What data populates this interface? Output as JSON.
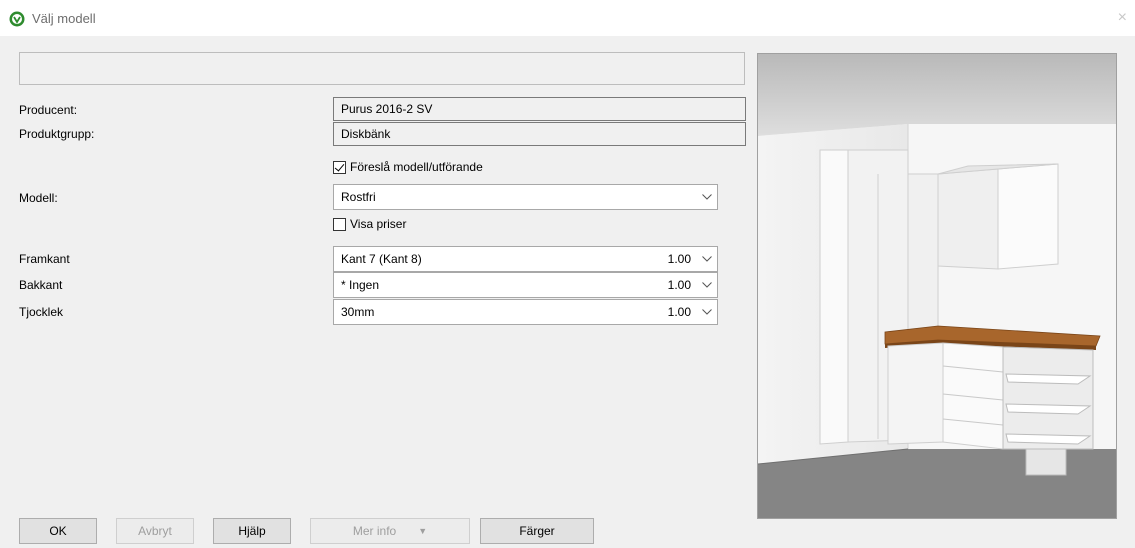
{
  "window": {
    "title": "Välj modell",
    "close_glyph": "×"
  },
  "form": {
    "producent_label": "Producent:",
    "producent_value": "Purus 2016-2 SV",
    "produktgrupp_label": "Produktgrupp:",
    "produktgrupp_value": "Diskbänk",
    "suggest_checkbox_label": "Föreslå modell/utförande",
    "suggest_checked": true,
    "modell_label": "Modell:",
    "modell_value": "Rostfri",
    "show_prices_label": "Visa priser",
    "show_prices_checked": false,
    "framkant_label": "Framkant",
    "framkant_value": "Kant 7 (Kant 8)",
    "framkant_num": "1.00",
    "bakkant_label": "Bakkant",
    "bakkant_value": "* Ingen",
    "bakkant_num": "1.00",
    "tjocklek_label": "Tjocklek",
    "tjocklek_value": "30mm",
    "tjocklek_num": "1.00"
  },
  "buttons": {
    "ok": "OK",
    "avbryt": "Avbryt",
    "hjalp": "Hjälp",
    "mer_info": "Mer info",
    "farger": "Färger"
  },
  "icons": {
    "app": "app-logo-icon",
    "close": "close-icon",
    "chevron": "chevron-down-icon",
    "check": "checkmark-icon"
  },
  "colors": {
    "countertop": "#a8662c",
    "floor": "#858585",
    "background": "#f0f0f0"
  }
}
